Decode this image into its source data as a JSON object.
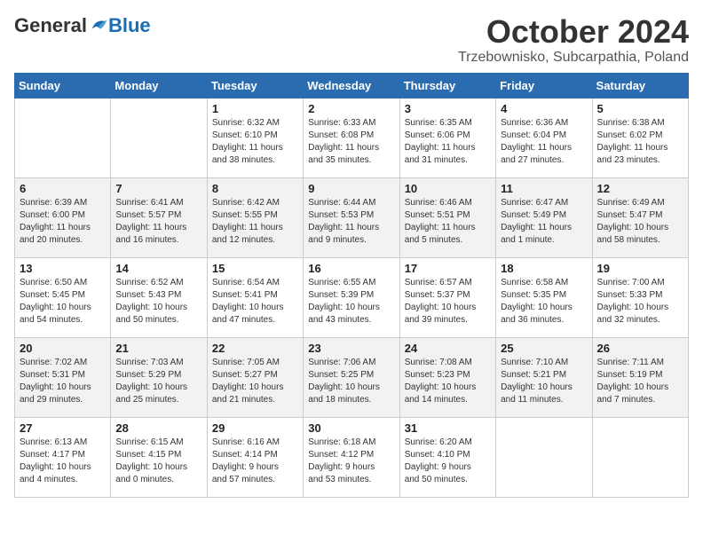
{
  "header": {
    "logo_general": "General",
    "logo_blue": "Blue",
    "month_title": "October 2024",
    "location": "Trzebownisko, Subcarpathia, Poland"
  },
  "weekdays": [
    "Sunday",
    "Monday",
    "Tuesday",
    "Wednesday",
    "Thursday",
    "Friday",
    "Saturday"
  ],
  "weeks": [
    [
      {
        "day": "",
        "info": ""
      },
      {
        "day": "",
        "info": ""
      },
      {
        "day": "1",
        "info": "Sunrise: 6:32 AM\nSunset: 6:10 PM\nDaylight: 11 hours\nand 38 minutes."
      },
      {
        "day": "2",
        "info": "Sunrise: 6:33 AM\nSunset: 6:08 PM\nDaylight: 11 hours\nand 35 minutes."
      },
      {
        "day": "3",
        "info": "Sunrise: 6:35 AM\nSunset: 6:06 PM\nDaylight: 11 hours\nand 31 minutes."
      },
      {
        "day": "4",
        "info": "Sunrise: 6:36 AM\nSunset: 6:04 PM\nDaylight: 11 hours\nand 27 minutes."
      },
      {
        "day": "5",
        "info": "Sunrise: 6:38 AM\nSunset: 6:02 PM\nDaylight: 11 hours\nand 23 minutes."
      }
    ],
    [
      {
        "day": "6",
        "info": "Sunrise: 6:39 AM\nSunset: 6:00 PM\nDaylight: 11 hours\nand 20 minutes."
      },
      {
        "day": "7",
        "info": "Sunrise: 6:41 AM\nSunset: 5:57 PM\nDaylight: 11 hours\nand 16 minutes."
      },
      {
        "day": "8",
        "info": "Sunrise: 6:42 AM\nSunset: 5:55 PM\nDaylight: 11 hours\nand 12 minutes."
      },
      {
        "day": "9",
        "info": "Sunrise: 6:44 AM\nSunset: 5:53 PM\nDaylight: 11 hours\nand 9 minutes."
      },
      {
        "day": "10",
        "info": "Sunrise: 6:46 AM\nSunset: 5:51 PM\nDaylight: 11 hours\nand 5 minutes."
      },
      {
        "day": "11",
        "info": "Sunrise: 6:47 AM\nSunset: 5:49 PM\nDaylight: 11 hours\nand 1 minute."
      },
      {
        "day": "12",
        "info": "Sunrise: 6:49 AM\nSunset: 5:47 PM\nDaylight: 10 hours\nand 58 minutes."
      }
    ],
    [
      {
        "day": "13",
        "info": "Sunrise: 6:50 AM\nSunset: 5:45 PM\nDaylight: 10 hours\nand 54 minutes."
      },
      {
        "day": "14",
        "info": "Sunrise: 6:52 AM\nSunset: 5:43 PM\nDaylight: 10 hours\nand 50 minutes."
      },
      {
        "day": "15",
        "info": "Sunrise: 6:54 AM\nSunset: 5:41 PM\nDaylight: 10 hours\nand 47 minutes."
      },
      {
        "day": "16",
        "info": "Sunrise: 6:55 AM\nSunset: 5:39 PM\nDaylight: 10 hours\nand 43 minutes."
      },
      {
        "day": "17",
        "info": "Sunrise: 6:57 AM\nSunset: 5:37 PM\nDaylight: 10 hours\nand 39 minutes."
      },
      {
        "day": "18",
        "info": "Sunrise: 6:58 AM\nSunset: 5:35 PM\nDaylight: 10 hours\nand 36 minutes."
      },
      {
        "day": "19",
        "info": "Sunrise: 7:00 AM\nSunset: 5:33 PM\nDaylight: 10 hours\nand 32 minutes."
      }
    ],
    [
      {
        "day": "20",
        "info": "Sunrise: 7:02 AM\nSunset: 5:31 PM\nDaylight: 10 hours\nand 29 minutes."
      },
      {
        "day": "21",
        "info": "Sunrise: 7:03 AM\nSunset: 5:29 PM\nDaylight: 10 hours\nand 25 minutes."
      },
      {
        "day": "22",
        "info": "Sunrise: 7:05 AM\nSunset: 5:27 PM\nDaylight: 10 hours\nand 21 minutes."
      },
      {
        "day": "23",
        "info": "Sunrise: 7:06 AM\nSunset: 5:25 PM\nDaylight: 10 hours\nand 18 minutes."
      },
      {
        "day": "24",
        "info": "Sunrise: 7:08 AM\nSunset: 5:23 PM\nDaylight: 10 hours\nand 14 minutes."
      },
      {
        "day": "25",
        "info": "Sunrise: 7:10 AM\nSunset: 5:21 PM\nDaylight: 10 hours\nand 11 minutes."
      },
      {
        "day": "26",
        "info": "Sunrise: 7:11 AM\nSunset: 5:19 PM\nDaylight: 10 hours\nand 7 minutes."
      }
    ],
    [
      {
        "day": "27",
        "info": "Sunrise: 6:13 AM\nSunset: 4:17 PM\nDaylight: 10 hours\nand 4 minutes."
      },
      {
        "day": "28",
        "info": "Sunrise: 6:15 AM\nSunset: 4:15 PM\nDaylight: 10 hours\nand 0 minutes."
      },
      {
        "day": "29",
        "info": "Sunrise: 6:16 AM\nSunset: 4:14 PM\nDaylight: 9 hours\nand 57 minutes."
      },
      {
        "day": "30",
        "info": "Sunrise: 6:18 AM\nSunset: 4:12 PM\nDaylight: 9 hours\nand 53 minutes."
      },
      {
        "day": "31",
        "info": "Sunrise: 6:20 AM\nSunset: 4:10 PM\nDaylight: 9 hours\nand 50 minutes."
      },
      {
        "day": "",
        "info": ""
      },
      {
        "day": "",
        "info": ""
      }
    ]
  ]
}
